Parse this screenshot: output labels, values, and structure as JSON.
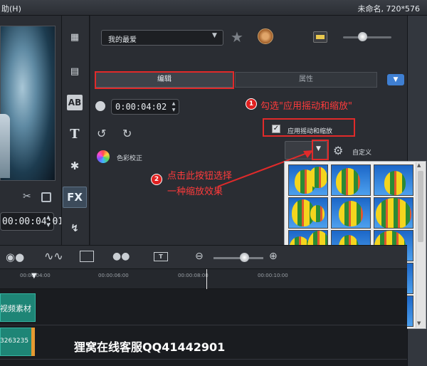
{
  "menubar": {
    "help": "助(H)",
    "project_title": "未命名, 720*576"
  },
  "preview": {
    "timecode": "00:00:04:01"
  },
  "tools": [
    "AB",
    "T",
    "FX"
  ],
  "options": {
    "preset_select": "我的最爱",
    "tabs": {
      "edit": "编辑",
      "attributes": "属性"
    },
    "timecode": "0:00:04:02",
    "color_correction": "色彩校正",
    "apply_pan_zoom": "应用摇动和缩放",
    "apply_pan_zoom_checked": true,
    "custom": "自定义"
  },
  "annotations": {
    "badge1": "1",
    "note1": "勾选\"应用摇动和缩放\"",
    "badge2": "2",
    "note2_line1": "点击此按钮选择",
    "note2_line2": "一种缩放效果"
  },
  "timeline": {
    "ruler_ticks": [
      "00:00:04:00",
      "00:00:06:00",
      "00:00:08:00",
      "00:00:10:00"
    ],
    "video_clip": "视频素材",
    "audio_clip": "3263235",
    "watermark": "狸窝在线客服QQ41442901"
  },
  "icons": [
    "star-icon",
    "reel-icon",
    "display-icon",
    "clock-icon",
    "rotate-left-icon",
    "rotate-right-icon",
    "color-wheel-icon",
    "gear-icon",
    "scissors-icon",
    "copy-icon",
    "record-icon",
    "audio-icon",
    "film-icon",
    "title-icon",
    "zoom-out-icon",
    "zoom-in-icon"
  ],
  "colors": {
    "highlight_red": "#e02a2a",
    "clip_teal": "#1e8576",
    "accent_blue": "#3f7fd2"
  }
}
